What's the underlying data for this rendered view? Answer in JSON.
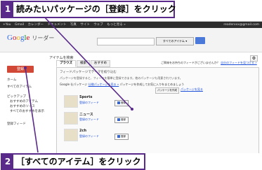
{
  "callouts": [
    {
      "num": "1",
      "text": "読みたいパッケージの［登録］をクリック"
    },
    {
      "num": "2",
      "text": "［すべてのアイテム］をクリック"
    }
  ],
  "google_bar": {
    "items": [
      "+You",
      "Gmail",
      "カレンダー",
      "ドキュメント",
      "写真",
      "サイト",
      "ウェブ",
      "もっと見る »"
    ],
    "account": "readerxxx@gmail.com"
  },
  "header": {
    "logo_letters": [
      "G",
      "o",
      "o",
      "g",
      "l",
      "e"
    ],
    "logo_sub": "リーダー",
    "search_scope_label": "すべてのアイテム ▾"
  },
  "subheader": {
    "title": "アイテムを検索"
  },
  "sidebar": {
    "register_button": "登録",
    "items": [
      "ホーム",
      "すべてのアイテム",
      "ピックアップ",
      "おすすめのアイテム",
      "おすすめのソース",
      "すべてのおすすめを表示",
      "登録フィード"
    ]
  },
  "main": {
    "tabs": [
      "ブラウズ",
      "検索",
      "おすすめ"
    ],
    "right_link_prefix": "ご興味をお持ちのフィードがございませんか？",
    "right_link": "自分のフィードを見つける »",
    "panel_header": "フィードパッケージでテーマを絞り込む",
    "panel_desc": "パッケージを登録すると、フィードを簡単に登録できます。他のパッケージも用意されています。",
    "gpack_prefix": "Google 仕パッケージ",
    "gpack_link": "仕様パッケージを見る »",
    "gpack_suffix": "パッケージを作成してお気に入りをまとめましょう",
    "create_button": "パッケージを作成",
    "create_link": "パッケージを見る",
    "packages": [
      {
        "name": "Sports",
        "sub": "登録のフィード",
        "btn": "登録"
      },
      {
        "name": "ニュース",
        "sub": "登録のフィード",
        "btn": "登録"
      },
      {
        "name": "2ch",
        "sub": "登録のフィード",
        "btn": "登録"
      }
    ]
  },
  "colors": {
    "accent": "#5a2a8a",
    "register": "#d14836",
    "link": "#1a4ed8",
    "topbar": "#2d2d2d"
  }
}
